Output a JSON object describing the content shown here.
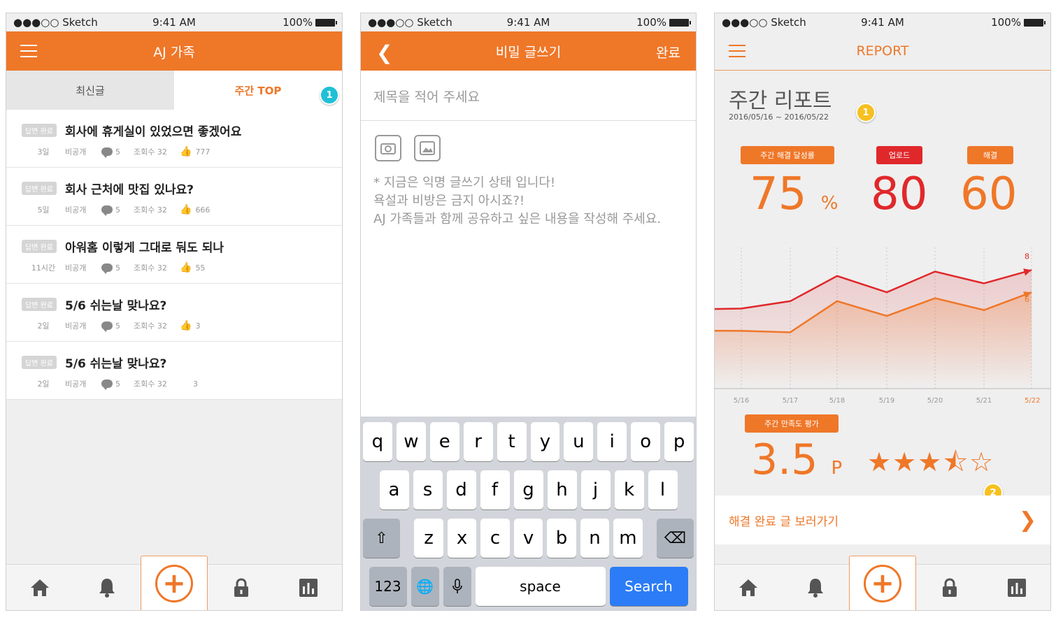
{
  "status": {
    "carrier": "●●●○○ Sketch",
    "time": "9:41 AM",
    "battery": "100%"
  },
  "colors": {
    "accent": "#ef7728",
    "red": "#e0282b",
    "cyan": "#1fc0d6",
    "yellow": "#f6c021"
  },
  "screen1": {
    "title": "AJ 가족",
    "tabs": [
      "최신글",
      "주간 TOP"
    ],
    "badge": "1",
    "items": [
      {
        "tag": "답변 완료",
        "title": "회사에 휴게실이 있었으면 좋겠어요",
        "age": "3일",
        "privacy": "비공개",
        "comments": "5",
        "views": "조회수 32",
        "likes": "777"
      },
      {
        "tag": "답변 완료",
        "title": "회사 근처에 맛집 있나요?",
        "age": "5일",
        "privacy": "비공개",
        "comments": "5",
        "views": "조회수 32",
        "likes": "666"
      },
      {
        "tag": "답변 완료",
        "title": "아워홈 이렇게 그대로 둬도 되나",
        "age": "11시간",
        "privacy": "비공개",
        "comments": "5",
        "views": "조회수 32",
        "likes": "55"
      },
      {
        "tag": "답변 완료",
        "title": "5/6 쉬는날 맞나요?",
        "age": "2일",
        "privacy": "비공개",
        "comments": "5",
        "views": "조회수 32",
        "likes": "3"
      },
      {
        "tag": "답변 완료",
        "title": "5/6 쉬는날 맞나요?",
        "age": "2일",
        "privacy": "비공개",
        "comments": "5",
        "views": "조회수 32",
        "likes": "3"
      }
    ]
  },
  "screen2": {
    "title": "비밀 글쓰기",
    "done": "완료",
    "title_placeholder": "제목을 적어 주세요",
    "notice": [
      "* 지금은 익명 글쓰기 상태 입니다!",
      "욕설과 비방은 금지 아시죠?!",
      "AJ 가족들과 함께 공유하고 싶은 내용을 작성해 주세요."
    ],
    "keyboard": {
      "row1": [
        "q",
        "w",
        "e",
        "r",
        "t",
        "y",
        "u",
        "i",
        "o",
        "p"
      ],
      "row2": [
        "a",
        "s",
        "d",
        "f",
        "g",
        "h",
        "j",
        "k",
        "l"
      ],
      "row3": [
        "z",
        "x",
        "c",
        "v",
        "b",
        "n",
        "m"
      ],
      "num": "123",
      "space": "space",
      "search": "Search"
    }
  },
  "screen3": {
    "title": "REPORT",
    "heading": "주간 리포트",
    "date_range": "2016/05/16 ~ 2016/05/22",
    "badge1": "1",
    "badge2": "2",
    "metrics": [
      {
        "label": "주간 해결 달성률",
        "value": "75",
        "unit": "%"
      },
      {
        "label": "업로드",
        "value": "80"
      },
      {
        "label": "해결",
        "value": "60"
      }
    ],
    "satisfaction_label": "주간 만족도 평가",
    "satisfaction_value": "3.5",
    "satisfaction_unit": "P",
    "satisfaction_rating": 3.5,
    "stars": "★★★⯪☆",
    "link_label": "해결 완료 글 보러가기"
  },
  "chart_data": {
    "type": "line",
    "categories": [
      "5/16",
      "5/17",
      "5/18",
      "5/19",
      "5/20",
      "5/21",
      "5/22"
    ],
    "series": [
      {
        "values": [
          5.4,
          5.9,
          7.6,
          6.5,
          7.9,
          7.1,
          8.0
        ],
        "color": "#e0282b"
      },
      {
        "values": [
          3.9,
          3.8,
          5.9,
          4.9,
          6.1,
          5.3,
          6.5
        ],
        "color": "#ef7728"
      }
    ],
    "end_labels": [
      "8",
      "6"
    ],
    "ylim": [
      0,
      10
    ]
  }
}
